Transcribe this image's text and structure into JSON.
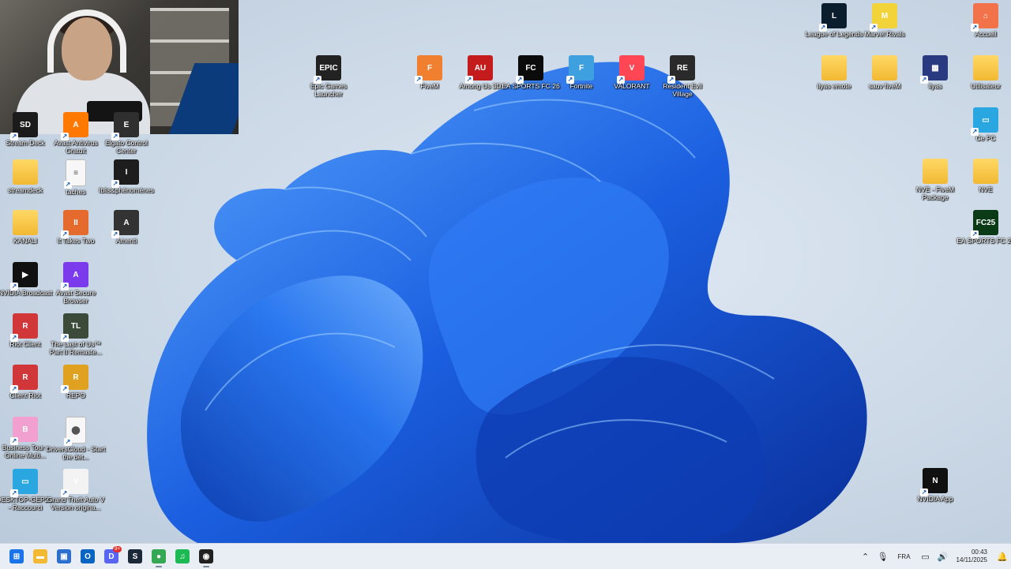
{
  "icons_left": [
    {
      "label": "Stream Deck",
      "type": "app",
      "color": "#1b1b1b",
      "glyph": "SD"
    },
    {
      "label": "Avast Antivirus Gratuit",
      "type": "app",
      "color": "#ff7800",
      "glyph": "A"
    },
    {
      "label": "Elgato Control Center",
      "type": "app",
      "color": "#2f2f2f",
      "glyph": "E"
    },
    {
      "label": "streamdeck",
      "type": "folder"
    },
    {
      "label": "taches",
      "type": "doc"
    },
    {
      "label": "Iblis&phénomènes",
      "type": "app",
      "color": "#1d1d1d",
      "glyph": "I"
    },
    {
      "label": "KANALI",
      "type": "folder"
    },
    {
      "label": "It Takes Two",
      "type": "app",
      "color": "#e46b2d",
      "glyph": "II"
    },
    {
      "label": "Amenti",
      "type": "app",
      "color": "#333333",
      "glyph": "A"
    },
    {
      "label": "NVIDIA Broadcast",
      "type": "app",
      "color": "#101010",
      "glyph": "▶"
    },
    {
      "label": "Avast Secure Browser",
      "type": "app",
      "color": "#7c3aed",
      "glyph": "A"
    },
    {
      "label": "Riot Client",
      "type": "app",
      "color": "#d13639",
      "glyph": "R"
    },
    {
      "label": "The Last of Us™ Part II Remaste...",
      "type": "app",
      "color": "#3c4a3a",
      "glyph": "TL"
    },
    {
      "label": "Client Riot",
      "type": "app",
      "color": "#d13639",
      "glyph": "R"
    },
    {
      "label": "REPO",
      "type": "app",
      "color": "#e0a020",
      "glyph": "R"
    },
    {
      "label": "Business Tour - Online Multi...",
      "type": "app",
      "color": "#f2a0d0",
      "glyph": "B"
    },
    {
      "label": "DriversCloud - Start the det...",
      "type": "doc",
      "glyph": "⬤"
    },
    {
      "label": "DESKTOP-GEP2... - Raccourci",
      "type": "app",
      "color": "#2aa6e0",
      "glyph": "▭"
    },
    {
      "label": "Grand Theft Auto V Version origina...",
      "type": "app",
      "color": "#f3f3f3",
      "glyph": "V"
    }
  ],
  "icons_top": [
    {
      "label": "Epic Games Launcher",
      "color": "#222222",
      "glyph": "EPIC"
    },
    {
      "label": "FiveM",
      "color": "#f08030",
      "glyph": "F"
    },
    {
      "label": "Among Us 3D",
      "color": "#c41c1c",
      "glyph": "AU"
    },
    {
      "label": "EA SPORTS FC 26",
      "color": "#0b0b0b",
      "glyph": "FC"
    },
    {
      "label": "Fortnite",
      "color": "#3fa0e0",
      "glyph": "F"
    },
    {
      "label": "VALORANT",
      "color": "#ff4655",
      "glyph": "V"
    },
    {
      "label": "Resident Evil Village",
      "color": "#2a2a2a",
      "glyph": "RE"
    }
  ],
  "icons_right": [
    {
      "label": "League of Legends",
      "type": "app",
      "color": "#0a1e2e",
      "glyph": "L"
    },
    {
      "label": "Marvel Rivals",
      "type": "app",
      "color": "#f3d33a",
      "glyph": "M"
    },
    {
      "label": "Accueil",
      "type": "app",
      "color": "#f2734a",
      "glyph": "⌂"
    },
    {
      "label": "ilyas emote",
      "type": "folder"
    },
    {
      "label": "sauv fiveM",
      "type": "folder"
    },
    {
      "label": "ilyas",
      "type": "app",
      "color": "#2a3a80",
      "glyph": "▦"
    },
    {
      "label": "Utilisateur",
      "type": "folder"
    },
    {
      "label": "Ce PC",
      "type": "app",
      "color": "#2aa6e0",
      "glyph": "▭"
    },
    {
      "label": "NVE - FiveM Package",
      "type": "folder"
    },
    {
      "label": "NVE",
      "type": "folder"
    },
    {
      "label": "EA SPORTS FC 25",
      "type": "app",
      "color": "#0b3a16",
      "glyph": "FC25"
    },
    {
      "label": "NVIDIA App",
      "type": "app",
      "color": "#101010",
      "glyph": "N"
    }
  ],
  "taskbar": {
    "apps": [
      {
        "name": "start-button",
        "glyph": "⊞",
        "color": "#1a73e8"
      },
      {
        "name": "file-explorer",
        "glyph": "▬",
        "color": "#f2b932"
      },
      {
        "name": "store",
        "glyph": "▣",
        "color": "#2c6fcf"
      },
      {
        "name": "outlook",
        "glyph": "O",
        "color": "#0a64c2"
      },
      {
        "name": "discord",
        "glyph": "D",
        "color": "#5865f2",
        "badge": "9+"
      },
      {
        "name": "steam",
        "glyph": "S",
        "color": "#1b2838"
      },
      {
        "name": "chrome",
        "glyph": "●",
        "color": "#34a853",
        "active": true
      },
      {
        "name": "spotify",
        "glyph": "♫",
        "color": "#1db954"
      },
      {
        "name": "obs",
        "glyph": "◉",
        "color": "#202020",
        "active": true
      }
    ],
    "language": "FRA",
    "time": "00:43",
    "date": "14/11/2025"
  },
  "colors": {
    "taskbar": "#e9eef5",
    "wallpaper_bloom": "#1c63e6"
  }
}
